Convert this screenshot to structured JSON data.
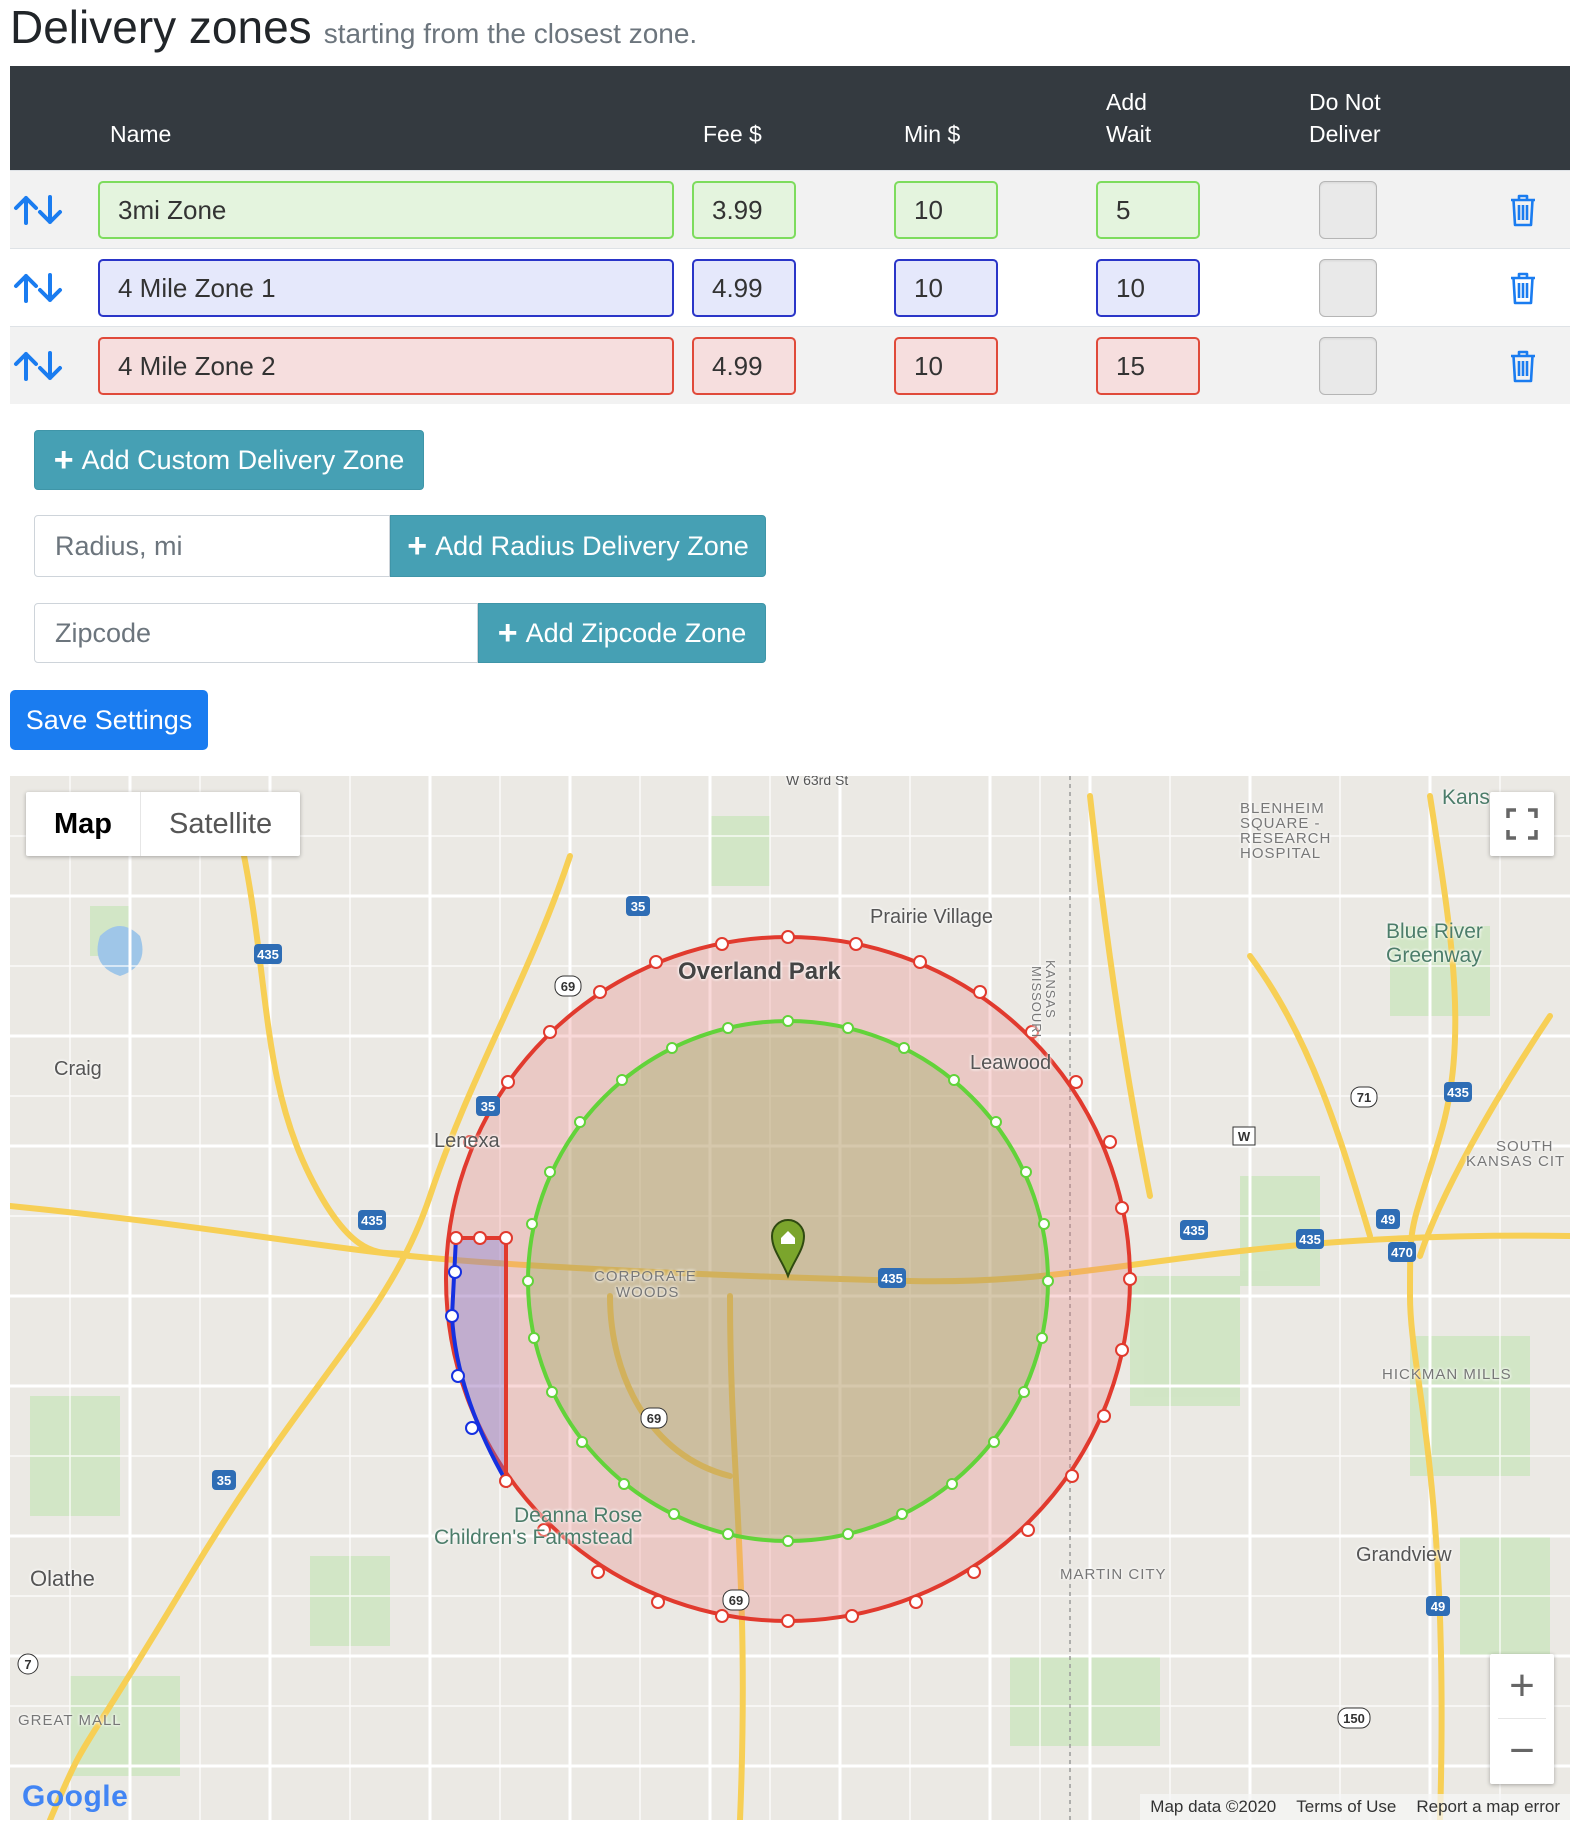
{
  "header": {
    "title": "Delivery zones",
    "subtitle": "starting from the closest zone."
  },
  "table": {
    "columns": {
      "name": "Name",
      "fee": "Fee $",
      "min": "Min $",
      "wait_line1": "Add",
      "wait_line2": "Wait",
      "dnd_line1": "Do Not",
      "dnd_line2": "Deliver"
    },
    "rows": [
      {
        "name": "3mi Zone",
        "fee": "3.99",
        "min": "10",
        "wait": "5",
        "color": "#7ddc5d",
        "do_not_deliver": false
      },
      {
        "name": "4 Mile Zone 1",
        "fee": "4.99",
        "min": "10",
        "wait": "10",
        "color": "#2a35c8",
        "do_not_deliver": false
      },
      {
        "name": "4 Mile Zone 2",
        "fee": "4.99",
        "min": "10",
        "wait": "15",
        "color": "#e04a3a",
        "do_not_deliver": false
      }
    ]
  },
  "actions": {
    "add_custom": "Add Custom Delivery Zone",
    "radius_placeholder": "Radius, mi",
    "add_radius": "Add Radius Delivery Zone",
    "zipcode_placeholder": "Zipcode",
    "add_zipcode": "Add Zipcode Zone",
    "save": "Save Settings"
  },
  "map": {
    "type_map": "Map",
    "type_satellite": "Satellite",
    "labels": {
      "overland_park": "Overland Park",
      "prairie_village": "Prairie Village",
      "leawood": "Leawood",
      "lenexa": "Lenexa",
      "craig": "Craig",
      "olathe": "Olathe",
      "blue_river_1": "Blue River",
      "blue_river_2": "Greenway",
      "grandview": "Grandview",
      "corporate_1": "CORPORATE",
      "corporate_2": "WOODS",
      "blenheim_1": "BLENHEIM",
      "blenheim_2": "SQUARE -",
      "blenheim_3": "RESEARCH",
      "blenheim_4": "HOSPITAL",
      "south_kc_1": "SOUTH",
      "south_kc_2": "KANSAS CIT",
      "hickman": "HICKMAN MILLS",
      "martin_city": "MARTIN CITY",
      "great_mall": "GREAT MALL",
      "deanna_1": "Deanna Rose",
      "deanna_2": "Children's Farmstead",
      "missouri": "MISSOURI",
      "kansas": "KANSAS",
      "kans": "Kans",
      "w63": "W 63rd St"
    },
    "footer": {
      "map_data": "Map data ©2020",
      "terms": "Terms of Use",
      "report": "Report a map error"
    },
    "logo": "Google",
    "zoom_in": "+",
    "zoom_out": "−"
  },
  "colors": {
    "header_bg": "#343a40",
    "info_button": "#46a0b4",
    "primary_button": "#1a7cf0",
    "zone_green": "#7ddc5d",
    "zone_blue": "#2a35c8",
    "zone_red": "#e04a3a",
    "icon_blue": "#1a7cf0"
  },
  "icons": {
    "sort": "arrows-up-down-icon",
    "trash": "trash-icon",
    "plus": "plus-icon",
    "fullscreen": "fullscreen-icon",
    "marker": "home-marker-icon"
  }
}
